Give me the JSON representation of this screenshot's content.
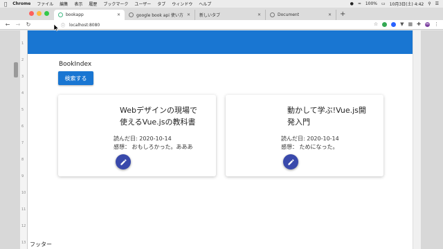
{
  "menubar": {
    "app": "Chrome",
    "items": [
      "ファイル",
      "編集",
      "表示",
      "履歴",
      "ブックマーク",
      "ユーザー",
      "タブ",
      "ウィンドウ",
      "ヘルプ"
    ],
    "battery": "100%",
    "datetime": "10月3日(土) 4:42"
  },
  "tabs": [
    {
      "label": "bookapp"
    },
    {
      "label": "google book api 使い方 - Google"
    },
    {
      "label": "新しいタブ"
    },
    {
      "label": "Document"
    }
  ],
  "toolbar": {
    "url": "localhost:8080",
    "avatar_letter": "m"
  },
  "ruler": [
    "1",
    "2",
    "3",
    "4",
    "5",
    "6",
    "7",
    "8",
    "9",
    "10",
    "11",
    "12",
    "13"
  ],
  "page": {
    "heading": "BookIndex",
    "search_button": "検索する",
    "footer": "フッター"
  },
  "books": [
    {
      "title": "Webデザインの現場で使えるVue.jsの教科書",
      "read_date": "読んだ日: 2020-10-14",
      "impression": "感想： おもしろかった。あああ"
    },
    {
      "title": "動かして学ぶ!Vue.js開発入門",
      "read_date": "読んだ日: 2020-10-14",
      "impression": "感想： ためになった。"
    }
  ],
  "colors": {
    "primary": "#1976d2",
    "fab": "#3949ab"
  }
}
